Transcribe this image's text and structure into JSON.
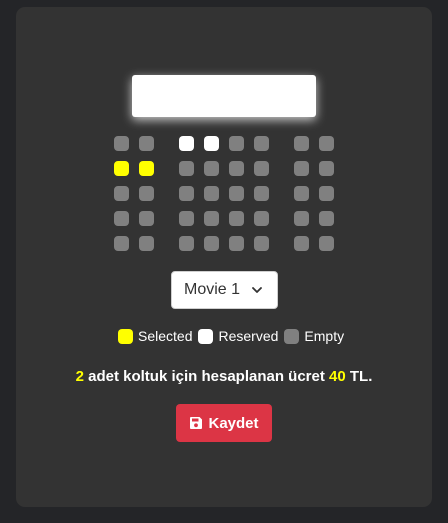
{
  "seats": {
    "colors": {
      "selected": "#ffff00",
      "reserved": "#ffffff",
      "empty": "#808080"
    },
    "rows": [
      [
        "empty",
        "empty",
        "reserved",
        "reserved",
        "empty",
        "empty",
        "empty",
        "empty"
      ],
      [
        "selected",
        "selected",
        "empty",
        "empty",
        "empty",
        "empty",
        "empty",
        "empty"
      ],
      [
        "empty",
        "empty",
        "empty",
        "empty",
        "empty",
        "empty",
        "empty",
        "empty"
      ],
      [
        "empty",
        "empty",
        "empty",
        "empty",
        "empty",
        "empty",
        "empty",
        "empty"
      ],
      [
        "empty",
        "empty",
        "empty",
        "empty",
        "empty",
        "empty",
        "empty",
        "empty"
      ]
    ]
  },
  "movie_select": {
    "value": "Movie 1",
    "icon": "chevron-down-icon"
  },
  "legend": {
    "selected_label": "Selected",
    "reserved_label": "Reserved",
    "empty_label": "Empty"
  },
  "summary": {
    "count": "2",
    "text_middle": "adet koltuk için hesaplanan ücret",
    "price": "40",
    "currency": "TL."
  },
  "save_button": {
    "label": "Kaydet",
    "icon": "save-icon"
  }
}
